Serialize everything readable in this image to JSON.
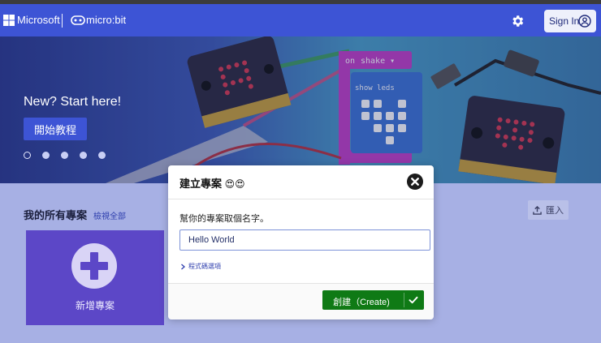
{
  "header": {
    "ms_label": "Microsoft",
    "mb_label": "micro:bit",
    "signin_label": "Sign In",
    "colors": {
      "bar": "#3d54d5",
      "signin_bg": "#eef0fb"
    },
    "icons": [
      "microsoft-logo-icon",
      "microbit-logo-icon",
      "gear-icon",
      "user-icon"
    ]
  },
  "hero": {
    "title": "New? Start here!",
    "tutorial_button": "開始教程",
    "code_blocks": {
      "event": "on",
      "event_value": "shake ▾",
      "action": "show leds"
    },
    "carousel": {
      "count": 5,
      "active": 0
    }
  },
  "projects": {
    "title": "我的所有專案",
    "view_all": "檢視全部",
    "import_label": "匯入",
    "new_project_label": "新增專案",
    "icons": [
      "import-icon",
      "plus-icon"
    ]
  },
  "modal": {
    "title": "建立專案",
    "emoji": "😍😍",
    "prompt": "幫你的專案取個名字。",
    "name_value": "Hello World",
    "code_options": "程式碼選項",
    "create_label": "創建（Create)",
    "colors": {
      "create": "#0f7a15",
      "input_border": "#7e93d8"
    },
    "icons": [
      "close-icon",
      "chevron-right-icon",
      "check-icon"
    ]
  }
}
